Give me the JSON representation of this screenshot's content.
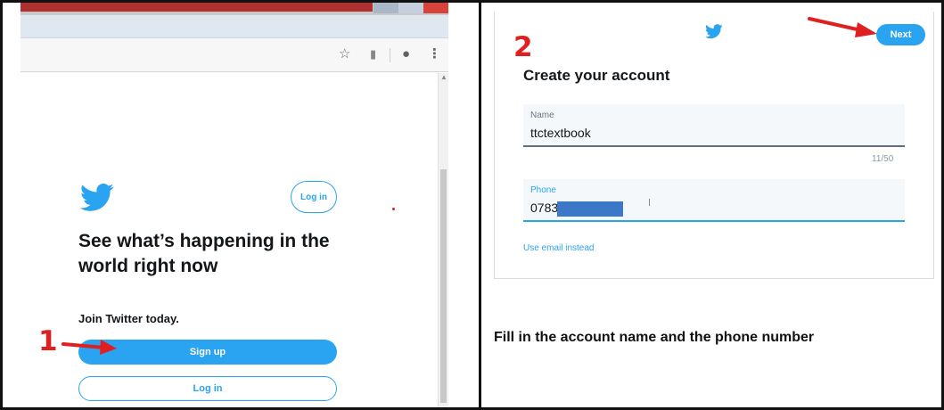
{
  "left_panel": {
    "step_number": "1",
    "toolbar_icons": [
      "star-icon",
      "extension-icon",
      "account-icon",
      "menu-icon"
    ],
    "log_in_small": "Log in",
    "headline": "See what’s happening in the world right now",
    "join": "Join Twitter today.",
    "sign_up": "Sign up",
    "log_in": "Log in"
  },
  "right_panel": {
    "step_number": "2",
    "next": "Next",
    "title": "Create your account",
    "name_label": "Name",
    "name_value": "ttctextbook",
    "name_counter": "11/50",
    "phone_label": "Phone",
    "phone_value": "0783",
    "use_email": "Use email instead",
    "caption": "Fill in the account name and the phone number"
  },
  "colors": {
    "twitter_blue": "#2aa3f0",
    "annotation_red": "#e02020",
    "redaction_blue": "#3c78c8"
  }
}
